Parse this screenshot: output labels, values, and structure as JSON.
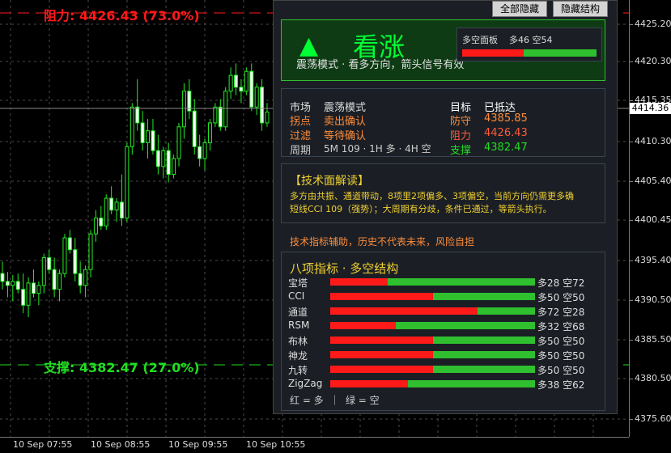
{
  "chart_data": {
    "type": "candlestick",
    "ylim": [
      4373.4,
      4428.5
    ],
    "y_ticks": [
      "4425.20",
      "4420.30",
      "4415.35",
      "4410.30",
      "4405.40",
      "4400.45",
      "4395.40",
      "4390.50",
      "4385.50",
      "4380.50",
      "4375.60"
    ],
    "x_labels": [
      "10 Sep 07:55",
      "10 Sep 08:55",
      "10 Sep 09:55",
      "10 Sep 10:55"
    ],
    "current_price": "4414.36",
    "resistance": 4426.43,
    "support": 4382.47,
    "candles": [
      [
        4394.0,
        4395.5,
        4392.0,
        4393.0
      ],
      [
        4393.0,
        4394.2,
        4391.0,
        4392.5
      ],
      [
        4392.5,
        4393.8,
        4390.5,
        4393.0
      ],
      [
        4393.0,
        4394.0,
        4391.5,
        4392.0
      ],
      [
        4392.0,
        4394.0,
        4389.0,
        4390.0
      ],
      [
        4390.0,
        4393.5,
        4388.5,
        4392.8
      ],
      [
        4392.8,
        4394.5,
        4391.0,
        4391.5
      ],
      [
        4391.5,
        4393.0,
        4390.0,
        4392.5
      ],
      [
        4392.5,
        4396.5,
        4391.5,
        4396.0
      ],
      [
        4396.0,
        4397.0,
        4394.0,
        4394.5
      ],
      [
        4394.5,
        4396.0,
        4391.0,
        4392.0
      ],
      [
        4392.0,
        4394.5,
        4390.5,
        4394.0
      ],
      [
        4394.0,
        4399.0,
        4393.5,
        4398.5
      ],
      [
        4398.5,
        4399.5,
        4396.5,
        4397.0
      ],
      [
        4397.0,
        4398.5,
        4393.0,
        4394.0
      ],
      [
        4394.0,
        4395.5,
        4391.5,
        4392.5
      ],
      [
        4392.5,
        4395.0,
        4391.0,
        4394.5
      ],
      [
        4394.5,
        4399.5,
        4393.5,
        4399.0
      ],
      [
        4399.0,
        4402.0,
        4398.0,
        4401.0
      ],
      [
        4401.0,
        4402.5,
        4399.5,
        4400.0
      ],
      [
        4400.0,
        4404.0,
        4399.5,
        4403.5
      ],
      [
        4403.5,
        4405.0,
        4401.5,
        4402.0
      ],
      [
        4402.0,
        4403.5,
        4400.5,
        4403.0
      ],
      [
        4403.0,
        4406.5,
        4400.0,
        4401.0
      ],
      [
        4401.0,
        4410.5,
        4400.5,
        4410.0
      ],
      [
        4410.0,
        4415.5,
        4409.0,
        4415.0
      ],
      [
        4415.0,
        4418.5,
        4412.0,
        4413.0
      ],
      [
        4413.0,
        4414.5,
        4409.5,
        4410.5
      ],
      [
        4410.5,
        4413.5,
        4408.5,
        4412.0
      ],
      [
        4412.0,
        4413.5,
        4409.0,
        4409.5
      ],
      [
        4409.5,
        4411.5,
        4406.5,
        4407.5
      ],
      [
        4407.5,
        4410.0,
        4406.0,
        4409.5
      ],
      [
        4409.5,
        4410.5,
        4405.5,
        4406.5
      ],
      [
        4406.5,
        4409.0,
        4406.0,
        4408.5
      ],
      [
        4408.5,
        4413.0,
        4407.5,
        4412.5
      ],
      [
        4412.5,
        4418.0,
        4411.0,
        4417.0
      ],
      [
        4417.0,
        4418.5,
        4413.5,
        4414.5
      ],
      [
        4414.5,
        4416.0,
        4409.0,
        4410.0
      ],
      [
        4410.0,
        4411.5,
        4407.5,
        4408.5
      ],
      [
        4408.5,
        4411.0,
        4407.0,
        4410.5
      ],
      [
        4410.5,
        4413.5,
        4409.5,
        4413.0
      ],
      [
        4413.0,
        4415.5,
        4412.5,
        4415.0
      ],
      [
        4415.0,
        4416.0,
        4412.0,
        4412.5
      ],
      [
        4412.5,
        4417.5,
        4412.0,
        4417.0
      ],
      [
        4417.0,
        4420.0,
        4416.0,
        4419.0
      ],
      [
        4419.0,
        4420.5,
        4416.5,
        4417.5
      ],
      [
        4417.5,
        4418.5,
        4415.5,
        4417.0
      ],
      [
        4417.0,
        4420.0,
        4416.5,
        4419.5
      ],
      [
        4419.5,
        4420.5,
        4414.5,
        4415.0
      ],
      [
        4415.0,
        4418.0,
        4414.0,
        4417.5
      ],
      [
        4417.5,
        4418.5,
        4412.0,
        4413.0
      ],
      [
        4413.0,
        4415.5,
        4412.5,
        4414.36
      ]
    ]
  },
  "chart_labels": {
    "resistance": "阻力: 4426.43 (73.0%)",
    "support": "支撑: 4382.47 (27.0%)"
  },
  "buttons": {
    "hide_all": "全部隐藏",
    "hide_structure": "隐藏结构"
  },
  "signal": {
    "arrow": "▲",
    "title": "看涨",
    "subtitle": "震荡模式 · 看多方向，箭头信号有效",
    "panel_label": "多空面板",
    "panel_values": "多46 空54",
    "bull": 46,
    "bear": 54
  },
  "status": {
    "row1": {
      "label": "市场",
      "value": "震荡模式",
      "label2": "目标",
      "value2": "已抵达"
    },
    "row2": {
      "label": "拐点",
      "value": "卖出确认",
      "label2": "防守",
      "value2": "4385.85"
    },
    "row3": {
      "label": "过滤",
      "value": "等待确认",
      "label2": "阻力",
      "value2": "4426.43"
    },
    "row4": {
      "label": "周期",
      "value": "5M 109 · 1H 多 · 4H 空",
      "label2": "支撑",
      "value2": "4382.47"
    }
  },
  "analysis": {
    "title": "【技术面解读】",
    "line1": "多方由共振、通道带动，8项里2项偏多、3项偏空，当前方向仍需更多确",
    "line2": "短线CCI 109（强势）；大周期有分歧，条件已通过，等箭头执行。"
  },
  "disclaimer": "技术指标辅助，历史不代表未来，风险自担",
  "indicators": {
    "title": "八项指标 · 多空结构",
    "legend": "红 = 多  ｜  绿 = 空",
    "items": [
      {
        "name": "宝塔",
        "bull": 28,
        "text": "多28 空72"
      },
      {
        "name": "CCI",
        "bull": 50,
        "text": "多50 空50"
      },
      {
        "name": "通道",
        "bull": 72,
        "text": "多72 空28"
      },
      {
        "name": "RSM",
        "bull": 32,
        "text": "多32 空68"
      },
      {
        "name": "布林",
        "bull": 50,
        "text": "多50 空50"
      },
      {
        "name": "神龙",
        "bull": 50,
        "text": "多50 空50"
      },
      {
        "name": "九转",
        "bull": 50,
        "text": "多50 空50"
      },
      {
        "name": "ZigZag",
        "bull": 38,
        "text": "多38 空62"
      }
    ]
  },
  "colors": {
    "bull_red": "#ff1a1a",
    "bear_green": "#2fbf2f",
    "label_orange": "#ff8c3a",
    "title_yellow": "#f0d030",
    "support_green": "#22dd22",
    "signal_green": "#00ff33"
  }
}
